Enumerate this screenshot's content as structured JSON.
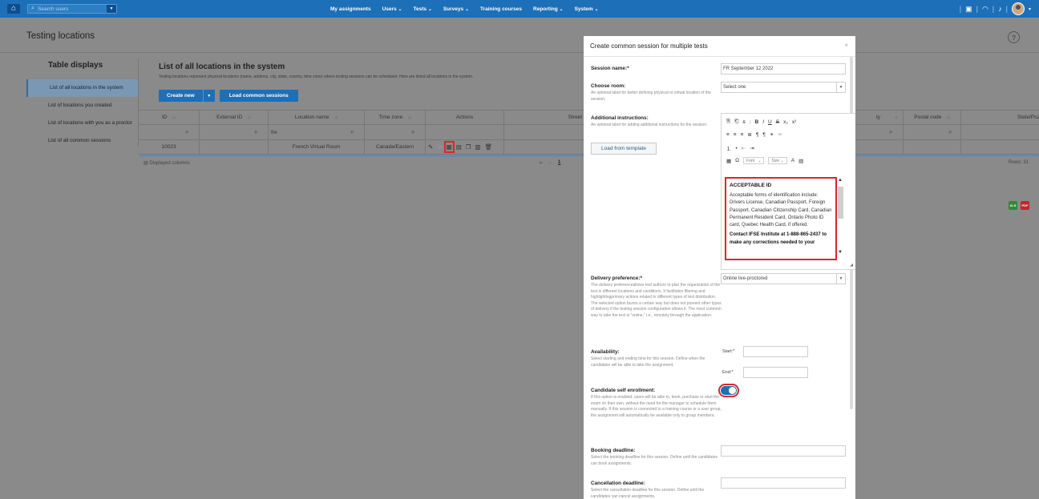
{
  "topbar": {
    "search_placeholder": "Search users",
    "nav": [
      "My assignments",
      "Users",
      "Tests",
      "Surveys",
      "Training courses",
      "Reporting",
      "System"
    ],
    "nav_dropdown": [
      false,
      true,
      true,
      true,
      false,
      true,
      true
    ]
  },
  "page": {
    "title": "Testing locations",
    "help": "?"
  },
  "sidebar": {
    "title": "Table displays",
    "items": [
      "List of all locations in the system",
      "List of locations you created",
      "List of locations with you as a proctor",
      "List of all common sessions"
    ],
    "active_index": 0
  },
  "list": {
    "title": "List of all locations in the system",
    "description": "Testing locations represent physical locations (name, address, city, state, country, time zone) where testing sessions can be scheduled. Here are listed all locations in the system.",
    "create_new": "Create new",
    "load_common": "Load common sessions",
    "columns": [
      "ID",
      "External ID",
      "Location name",
      "Time zone",
      "Actions",
      "Street",
      "ty",
      "Postal code",
      "State/Pro"
    ],
    "filter_location_name": "fre",
    "row": {
      "id": "10023",
      "location_name": "French Virtual Room",
      "time_zone": "Canada/Eastern"
    },
    "displayed_columns": "Displayed columns",
    "page": "1",
    "rows": "Rows: 31"
  },
  "modal": {
    "title": "Create common session for multiple tests",
    "close": "×",
    "session_name_label": "Session name:*",
    "session_name_value": "FR September 12 2022",
    "room_label": "Choose room:",
    "room_help": "An optional label for better defining physical or virtual location of the session.",
    "room_value": "Select one",
    "instructions_label": "Additional instructions:",
    "instructions_help": "An optional label for adding additional instructions for the session.",
    "load_template": "Load from template",
    "toolbar_font": "Font",
    "toolbar_size": "Size",
    "editor_heading": "ACCEPTABLE ID",
    "editor_body": "Acceptable forms of identification include: Drivers License, Canadian Passport, Foreign Passport, Canadian Citizenship Card, Canadian Permanent Resident Card, Ontario Photo ID card, Quebec Health Card, if offered.",
    "editor_contact": "Contact IFSE Institute at 1-888-865-2437 to make any corrections needed to your",
    "delivery_label": "Delivery preference:*",
    "delivery_help": "The delivery preferenceallows test authors to plan the organization of the test in different locations and conditions. It facilitates filtering and highlightingprimary actions related to different types of test distribution. The selected option favors a certain way but does not prevent other types of delivery if the testing session configuration allows it. The most common way to take the test is \"online,\" i.e., remotely through the application.",
    "delivery_value": "Online live-proctored",
    "availability_label": "Availability:",
    "availability_help": "Select starting and ending time for this session. Define when the candidates will be able to take the assignment.",
    "start_label": "Start:*",
    "end_label": "End:*",
    "self_enrol_label": "Candidate self enrollment:",
    "self_enrol_help": "If this option is enabled, users will be able to, book, purchase or start the exam on their own, without the need for the manager to schedule them manually. If this session is connected to a training course or a user group, the assignment will automatically be available only to group members.",
    "booking_label": "Booking deadline:",
    "booking_help": "Select the booking deadline for this session. Define until the candidates can book assignments.",
    "cancel_label": "Cancellation deadline:",
    "cancel_help": "Select the cancellation deadline for this session. Define until the candidates can cancel assignments."
  },
  "colors": {
    "brand": "#1d6fb8",
    "highlight": "#d9262c",
    "overlay": "#8a8a8a"
  }
}
